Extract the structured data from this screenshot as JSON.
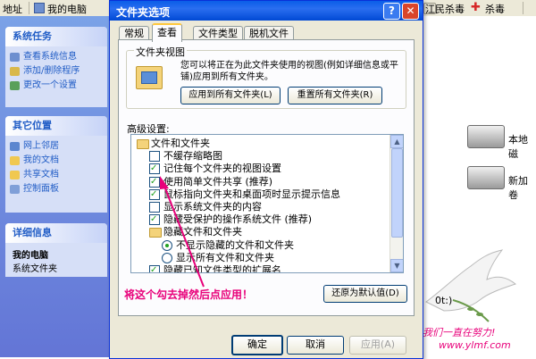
{
  "topbar": {
    "address_label": "地址",
    "my_computer": "我的电脑",
    "jiangmin": "江民杀毒",
    "kill_virus": "杀毒"
  },
  "sidebar": {
    "system_tasks": {
      "title": "系统任务",
      "items": [
        "查看系统信息",
        "添加/删除程序",
        "更改一个设置"
      ]
    },
    "other_places": {
      "title": "其它位置",
      "items": [
        "网上邻居",
        "我的文档",
        "共享文档",
        "控制面板"
      ]
    },
    "details": {
      "title": "详细信息",
      "name": "我的电脑",
      "desc": "系统文件夹"
    }
  },
  "right": {
    "drive1": "本地磁",
    "drive2": "新加卷",
    "fragment": "0t:)"
  },
  "dialog": {
    "title": "文件夹选项",
    "tabs": [
      "常规",
      "查看",
      "文件类型",
      "脱机文件"
    ],
    "active_tab": "查看",
    "folder_views": {
      "legend": "文件夹视图",
      "text": "您可以将正在为此文件夹使用的视图(例如详细信息或平铺)应用到所有文件夹。",
      "apply_all": "应用到所有文件夹(L)",
      "reset_all": "重置所有文件夹(R)"
    },
    "advanced_label": "高级设置:",
    "tree": [
      {
        "kind": "folder",
        "label": "文件和文件夹",
        "indent": 0
      },
      {
        "kind": "checkbox",
        "label": "不缓存缩略图",
        "checked": false,
        "indent": 1
      },
      {
        "kind": "checkbox",
        "label": "记住每个文件夹的视图设置",
        "checked": true,
        "indent": 1
      },
      {
        "kind": "checkbox",
        "label": "使用简单文件共享 (推荐)",
        "checked": true,
        "indent": 1
      },
      {
        "kind": "checkbox",
        "label": "鼠标指向文件夹和桌面项时显示提示信息",
        "checked": true,
        "indent": 1
      },
      {
        "kind": "checkbox",
        "label": "显示系统文件夹的内容",
        "checked": false,
        "indent": 1
      },
      {
        "kind": "checkbox",
        "label": "隐藏受保护的操作系统文件 (推荐)",
        "checked": true,
        "indent": 1
      },
      {
        "kind": "folder",
        "label": "隐藏文件和文件夹",
        "indent": 1
      },
      {
        "kind": "radio",
        "label": "不显示隐藏的文件和文件夹",
        "checked": true,
        "indent": 2
      },
      {
        "kind": "radio",
        "label": "显示所有文件和文件夹",
        "checked": false,
        "indent": 2
      },
      {
        "kind": "checkbox",
        "label": "隐藏已知文件类型的扩展名",
        "checked": true,
        "indent": 1
      }
    ],
    "restore_defaults": "还原为默认值(D)",
    "annotation": "将这个勾去掉然后点应用！",
    "ok": "确定",
    "cancel": "取消",
    "apply": "应用(A)"
  },
  "watermark": {
    "line1": "我们一直在努力!",
    "url": "www.ylmf.com"
  },
  "colors": {
    "xp_blue": "#0a5ee8",
    "annotation_pink": "#e8007a",
    "check_green": "#21a121"
  }
}
